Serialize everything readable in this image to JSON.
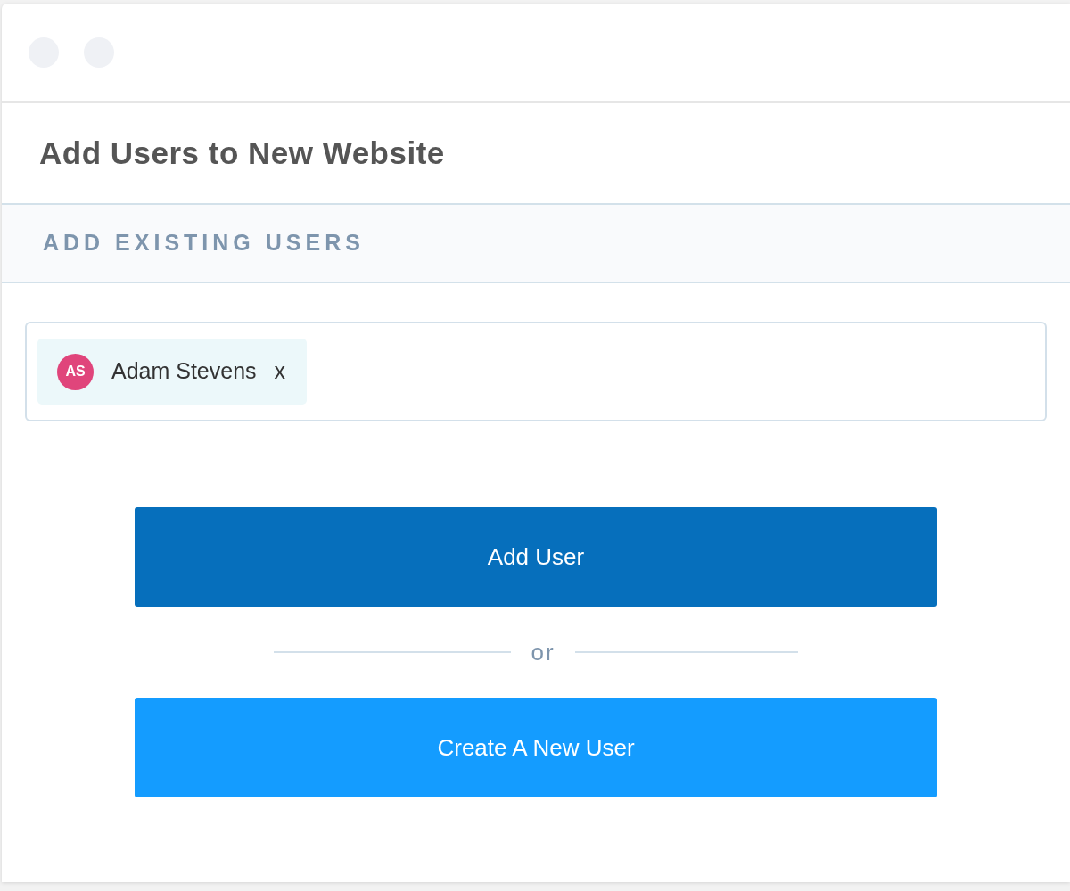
{
  "window": {
    "title": "Add Users to New Website"
  },
  "section": {
    "heading": "ADD EXISTING USERS"
  },
  "user_field": {
    "chips": [
      {
        "initials": "AS",
        "name": "Adam Stevens",
        "remove": "x",
        "color": "#e0457b"
      }
    ]
  },
  "buttons": [
    {
      "kind": "primary",
      "label": "Add User"
    },
    {
      "kind": "secondary",
      "label": "Create A New User"
    }
  ],
  "divider_text": "or"
}
